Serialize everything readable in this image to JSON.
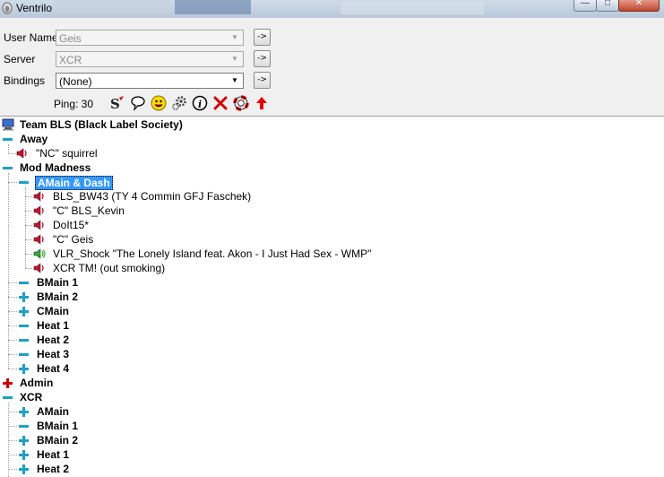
{
  "window": {
    "title": "Ventrilo"
  },
  "form": {
    "user_name_label": "User Name",
    "user_name_value": "Geis",
    "server_label": "Server",
    "server_value": "XCR",
    "bindings_label": "Bindings",
    "bindings_value": "(None)",
    "go_label": "->"
  },
  "toolbar": {
    "ping": "Ping: 30",
    "icons": [
      "setup-icon",
      "chat-bubble-icon",
      "smiley-icon",
      "settings-gear-icon",
      "info-icon",
      "disconnect-x-icon",
      "lifebuoy-icon",
      "up-arrow-icon"
    ]
  },
  "tree": {
    "server": "Team BLS (Black Label Society)",
    "away": {
      "name": "Away",
      "users": [
        "\"NC\" squirrel"
      ]
    },
    "mod_madness": {
      "name": "Mod Madness",
      "amain_dash": {
        "name": "AMain & Dash",
        "users": [
          "BLS_BW43 (TY 4 Commin GFJ Faschek)",
          "\"C\" BLS_Kevin",
          "DoIt15*",
          "\"C\" Geis",
          "VLR_Shock \"The Lonely Island feat. Akon - I Just Had Sex - WMP\"",
          "XCR TM! (out smoking)"
        ],
        "talking_index": 4
      },
      "channels": [
        "BMain 1",
        "BMain 2",
        "CMain",
        "Heat 1",
        "Heat 2",
        "Heat 3",
        "Heat 4"
      ],
      "channel_expand": [
        "minus",
        "plus",
        "plus",
        "minus",
        "minus",
        "minus",
        "plus"
      ]
    },
    "admin": {
      "name": "Admin"
    },
    "xcr": {
      "name": "XCR",
      "channels": [
        "AMain",
        "BMain 1",
        "BMain 2",
        "Heat 1",
        "Heat 2"
      ],
      "channel_expand": [
        "plus",
        "minus",
        "plus",
        "plus",
        "plus"
      ]
    }
  },
  "colors": {
    "accent_selected": "#3399ff",
    "channel_icon": "#1ea0c8",
    "admin_icon": "#d00000",
    "speaker_red": "#c8102e",
    "speaker_green": "#2eaa2e"
  }
}
